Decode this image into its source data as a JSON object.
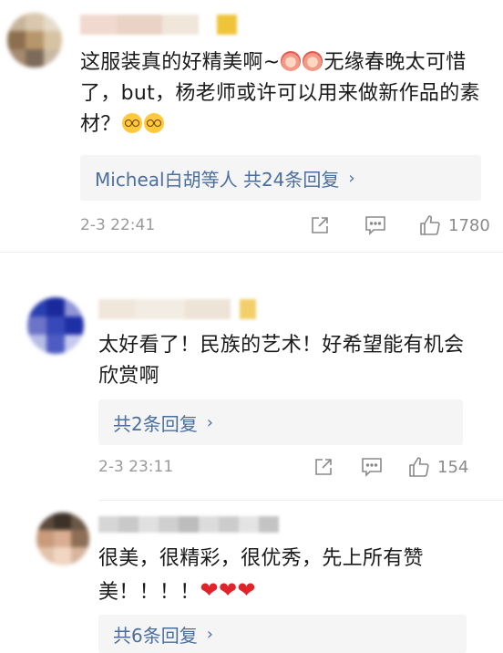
{
  "comments": [
    {
      "text_parts": [
        "这服装真的好精美啊~",
        "无缘春晚太可惜了，but，杨老师或许可以用来做新作品的素材？"
      ],
      "emojis_mid": [
        "shocked-face",
        "shocked-face"
      ],
      "emojis_end": [
        "nerd-face",
        "nerd-face"
      ],
      "reply_summary": "Micheal白胡等人 共24条回复",
      "timestamp": "2-3 22:41",
      "likes": "1780"
    },
    {
      "text": "太好看了！民族的艺术！好希望能有机会欣赏啊",
      "reply_summary": "共2条回复",
      "timestamp": "2-3 23:11",
      "likes": "154"
    },
    {
      "text": "很美，很精彩，很优秀，先上所有赞美！！！！",
      "emojis_end": [
        "heart",
        "heart",
        "heart"
      ],
      "reply_summary": "共6条回复"
    }
  ],
  "icons": {
    "share": "share-icon",
    "comment": "comment-icon",
    "like": "thumbs-up-icon",
    "chevron": "chevron-right-icon"
  },
  "colors": {
    "reply_link": "#4a6f9f",
    "meta_text": "#9a9a9a",
    "heart": "#e0242b"
  }
}
